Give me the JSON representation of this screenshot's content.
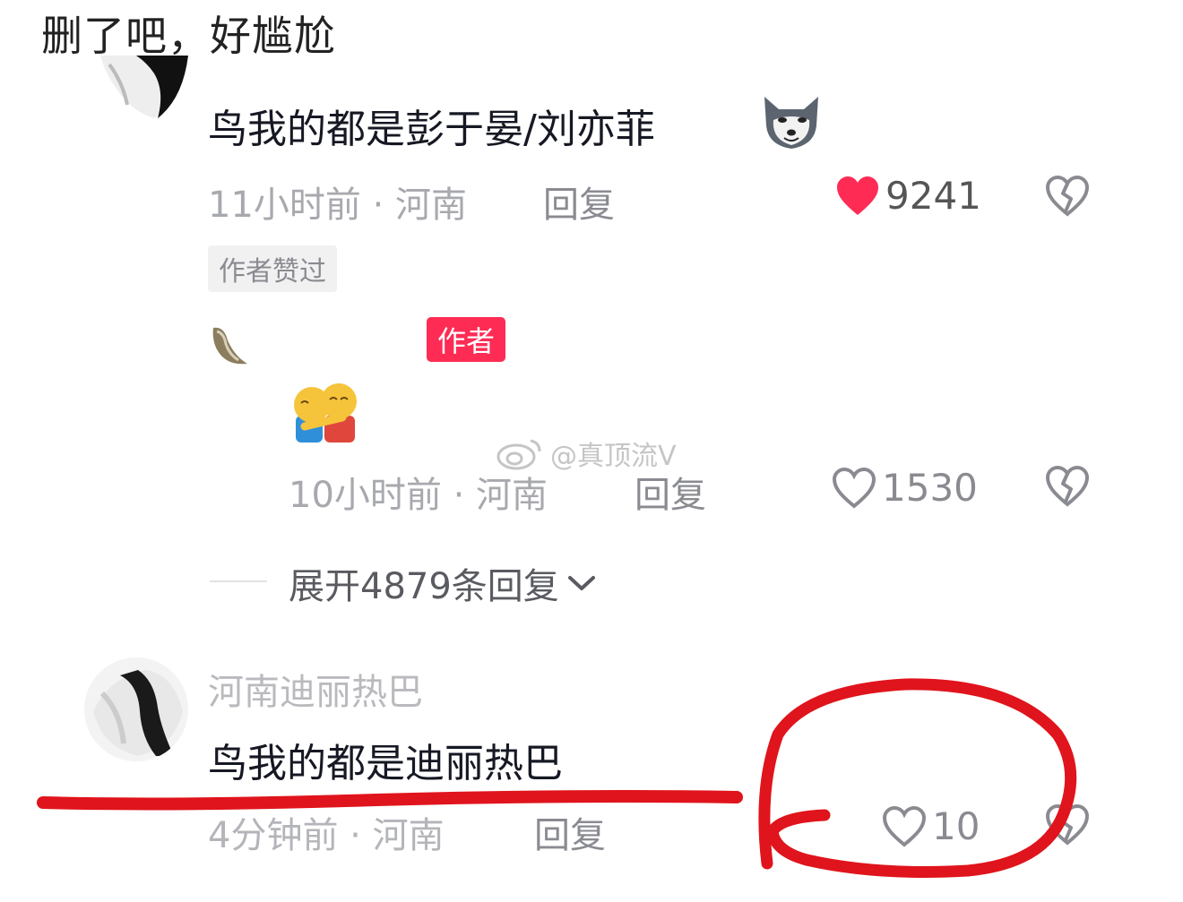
{
  "caption": "删了吧，好尴尬",
  "comment1": {
    "text": "鸟我的都是彭于晏/刘亦菲",
    "time": "11小时前 · 河南",
    "reply": "回复",
    "likes": "9241",
    "badge": "作者赞过",
    "emoji": "husky-emoji"
  },
  "author_reply": {
    "tag": "作者",
    "emoji": "hug-emoji",
    "time": "10小时前 · 河南",
    "reply": "回复",
    "likes": "1530"
  },
  "expand_label": "展开4879条回复",
  "comment2": {
    "username": "河南迪丽热巴",
    "text": "鸟我的都是迪丽热巴",
    "time": "4分钟前 · 河南",
    "reply": "回复",
    "likes": "10"
  },
  "watermark": "@真顶流V",
  "colors": {
    "like_active": "#fe2c55",
    "author_tag": "#fe2c55",
    "annotation": "#e0141c"
  }
}
